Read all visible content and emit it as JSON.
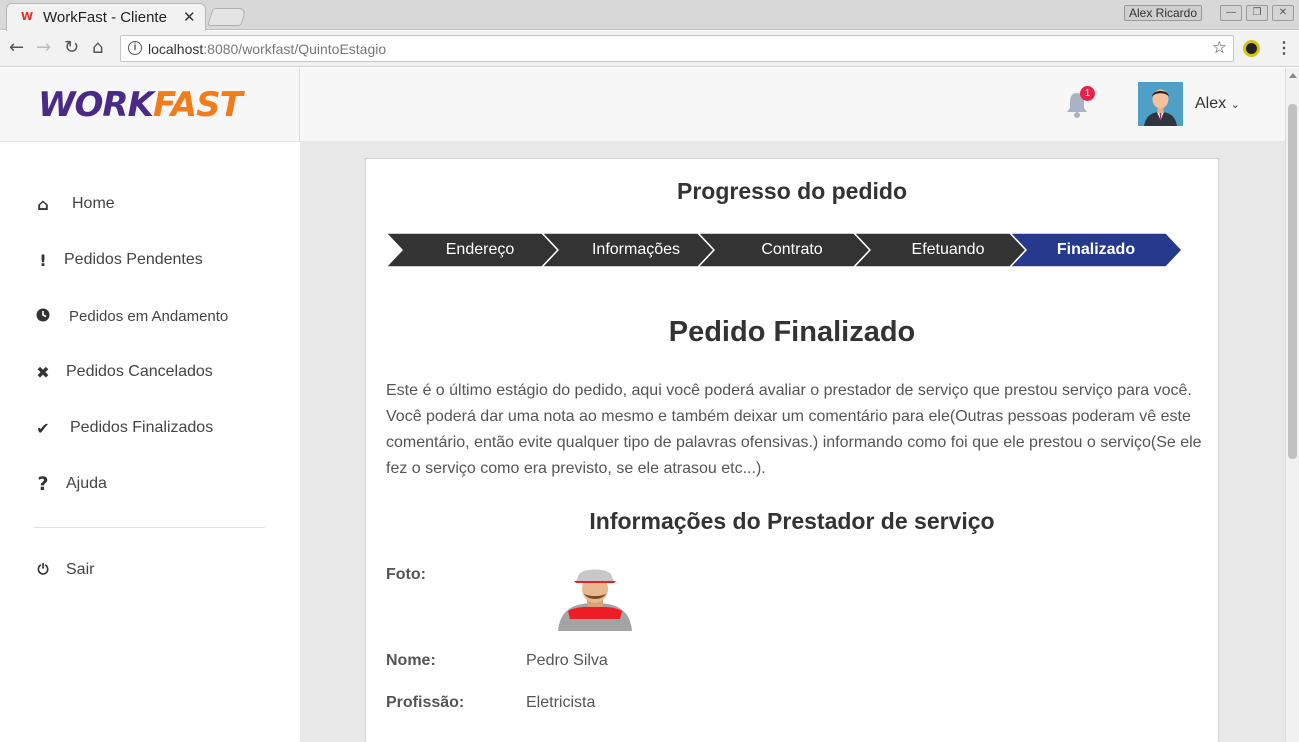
{
  "browser": {
    "tab_title": "WorkFast - Cliente",
    "favicon": "W",
    "url_host": "localhost",
    "url_rest": ":8080/workfast/QuintoEstagio",
    "os_user": "Alex Ricardo"
  },
  "brand": {
    "work": "WORK",
    "fast": "FAST"
  },
  "topbar": {
    "notification_count": "1",
    "user_name": "Alex"
  },
  "sidebar": {
    "items": [
      {
        "label": "Home",
        "icon": "home-icon"
      },
      {
        "label": "Pedidos Pendentes",
        "icon": "exclamation-icon"
      },
      {
        "label": "Pedidos em Andamento",
        "icon": "clock-icon"
      },
      {
        "label": "Pedidos Cancelados",
        "icon": "times-icon"
      },
      {
        "label": "Pedidos Finalizados",
        "icon": "check-icon"
      },
      {
        "label": "Ajuda",
        "icon": "question-icon"
      }
    ],
    "logout": {
      "label": "Sair",
      "icon": "power-icon"
    }
  },
  "main": {
    "progress_title": "Progresso do pedido",
    "steps": [
      "Endereço",
      "Informações",
      "Contrato",
      "Efetuando",
      "Finalizado"
    ],
    "active_step": "Finalizado",
    "final_title": "Pedido Finalizado",
    "description": "Este é o último estágio do pedido, aqui você poderá avaliar o prestador de serviço que prestou serviço para você. Você poderá dar uma nota ao mesmo e também deixar um comentário para ele(Outras pessoas poderam vê este comentário, então evite qualquer tipo de palavras ofensivas.) informando como foi que ele prestou o serviço(Se ele fez o serviço como era previsto, se ele atrasou etc...).",
    "provider_title": "Informações do Prestador de serviço",
    "photo_label": "Foto:",
    "name_label": "Nome:",
    "name_value": "Pedro Silva",
    "profession_label": "Profissão:",
    "profession_value": "Eletricista"
  },
  "colors": {
    "active_step": "#27398d",
    "step": "#333333",
    "brand_work": "#4a2a86",
    "brand_fast": "#f07d1a",
    "badge": "#e8214a"
  }
}
